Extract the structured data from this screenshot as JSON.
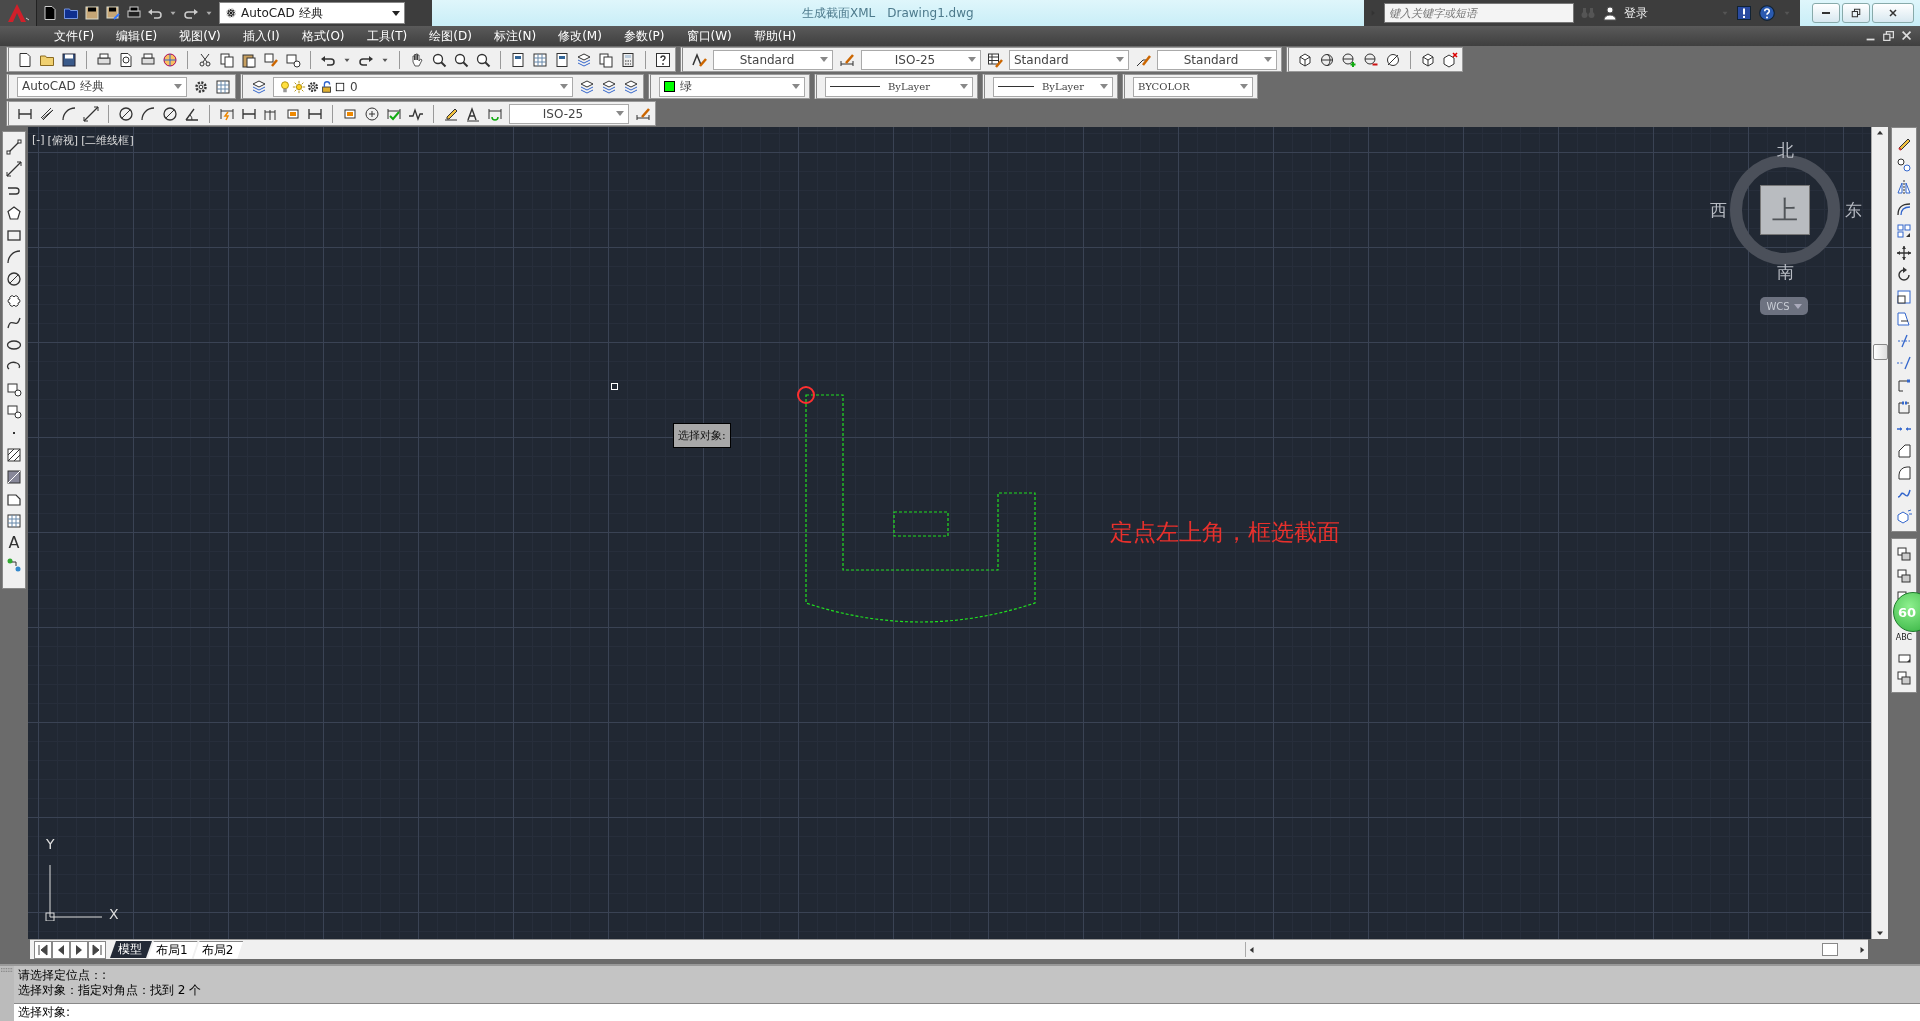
{
  "title_bar": {
    "workspace": "AutoCAD 经典",
    "title": "生成截面XML",
    "file_name": "Drawing1.dwg",
    "search": {
      "placeholder": "键入关键字或短语"
    },
    "sign_in": "登录"
  },
  "menu": [
    "文件(F)",
    "编辑(E)",
    "视图(V)",
    "插入(I)",
    "格式(O)",
    "工具(T)",
    "绘图(D)",
    "标注(N)",
    "修改(M)",
    "参数(P)",
    "窗口(W)",
    "帮助(H)"
  ],
  "toolbars": {
    "text_style": "Standard",
    "dim_style": "ISO-25",
    "table_style": "Standard",
    "multileader_style": "Standard",
    "workspace": "AutoCAD 经典",
    "layer": "0",
    "color_name": "绿",
    "linetype": "ByLayer",
    "lineweight": "ByLayer",
    "plot_style": "BYCOLOR",
    "dimension_style": "ISO-25"
  },
  "left_toolbar": {
    "text_tool": "A"
  },
  "right_toolbar": {
    "text_edit": "ABC"
  },
  "viewport": {
    "labels": [
      "[-]",
      "[俯视]",
      "[二维线框]"
    ],
    "tooltip": "选择对象:",
    "annotation": "定点左上角，框选截面",
    "ucs": {
      "x": "X",
      "y": "Y"
    }
  },
  "view_cube": {
    "north": "北",
    "south": "南",
    "west": "西",
    "east": "东",
    "face": "上",
    "coordinate_system": "WCS"
  },
  "badge": "60",
  "layout_tabs": [
    {
      "label": "模型",
      "selected": true
    },
    {
      "label": "布局1",
      "selected": false
    },
    {
      "label": "布局2",
      "selected": false
    }
  ],
  "command": {
    "history": [
      "请选择定位点：:",
      "选择对象：指定对角点：找到 2 个"
    ],
    "prompt": "选择对象:"
  }
}
